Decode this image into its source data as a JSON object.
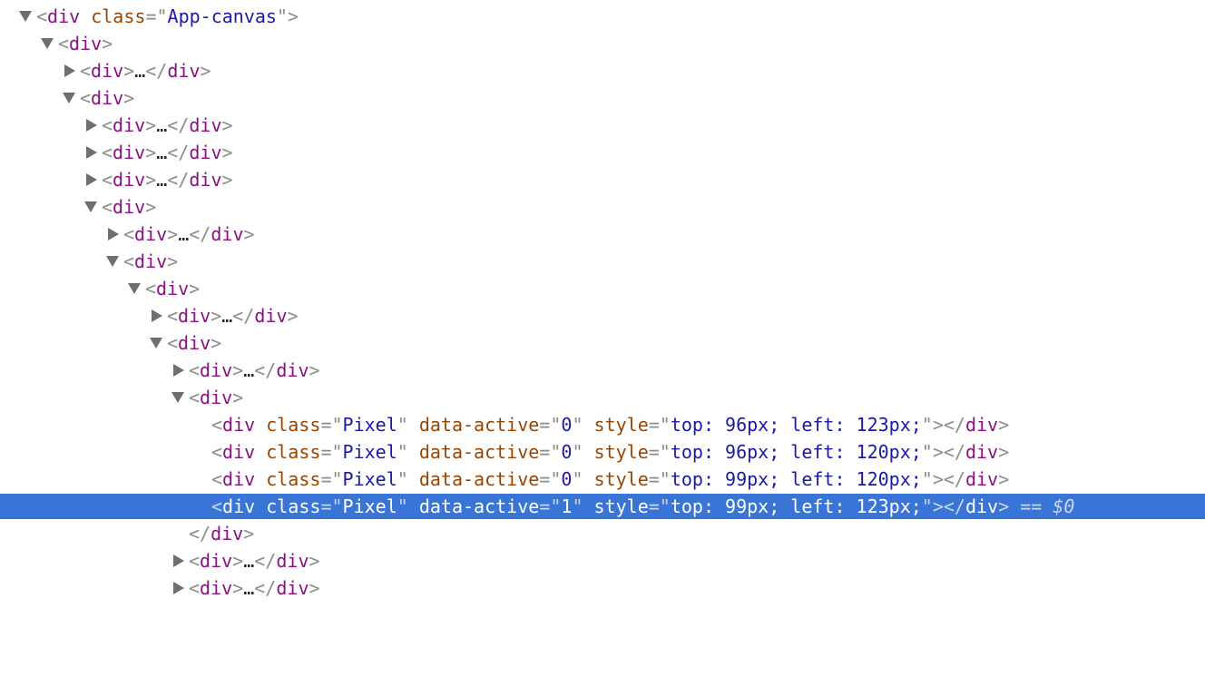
{
  "tree": {
    "root": {
      "tag": "div",
      "attr": "class",
      "attr_value": "App-canvas"
    },
    "tag_div": "div",
    "ellipsis": "…",
    "pixels": [
      {
        "class": "Pixel",
        "active": "0",
        "style": "top: 96px; left: 123px;"
      },
      {
        "class": "Pixel",
        "active": "0",
        "style": "top: 96px; left: 120px;"
      },
      {
        "class": "Pixel",
        "active": "0",
        "style": "top: 99px; left: 120px;"
      },
      {
        "class": "Pixel",
        "active": "1",
        "style": "top: 99px; left: 123px;"
      }
    ],
    "attr_class": "class",
    "attr_data_active": "data-active",
    "attr_style": "style",
    "selected_marker": "== $0",
    "colors": {
      "selection": "#3875d7",
      "tag": "#881280",
      "attribute": "#994500",
      "value": "#1a1aa6"
    }
  }
}
